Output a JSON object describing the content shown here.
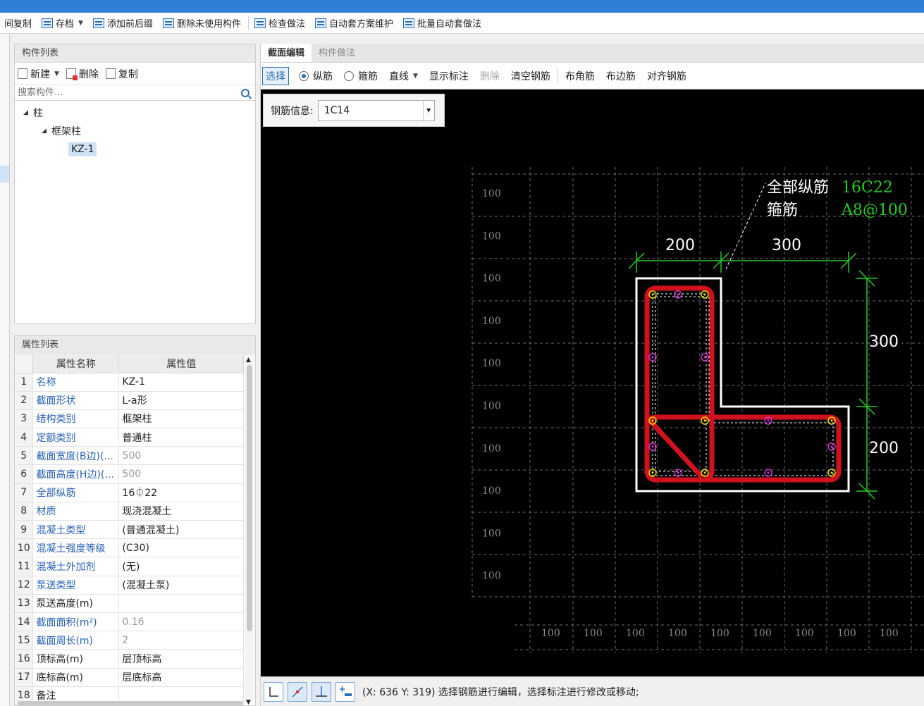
{
  "toolbar": {
    "items": [
      "间复制",
      "存档",
      "添加前后缀",
      "删除未使用构件",
      "检查做法",
      "自动套方案维护",
      "批量自动套做法"
    ]
  },
  "component_panel": {
    "title": "构件列表",
    "new_label": "新建",
    "delete_label": "删除",
    "copy_label": "复制",
    "search_placeholder": "搜索构件...",
    "tree": {
      "root": "柱",
      "child": "框架柱",
      "leaf": "KZ-1"
    }
  },
  "property_panel": {
    "title": "属性列表",
    "col_name": "属性名称",
    "col_value": "属性值",
    "rows": [
      {
        "n": "1",
        "name": "名称",
        "value": "KZ-1"
      },
      {
        "n": "2",
        "name": "截面形状",
        "value": "L-a形"
      },
      {
        "n": "3",
        "name": "结构类别",
        "value": "框架柱"
      },
      {
        "n": "4",
        "name": "定额类别",
        "value": "普通柱"
      },
      {
        "n": "5",
        "name": "截面宽度(B边)(...",
        "value": "500"
      },
      {
        "n": "6",
        "name": "截面高度(H边)(...",
        "value": "500"
      },
      {
        "n": "7",
        "name": "全部纵筋",
        "value": "16⏀22"
      },
      {
        "n": "8",
        "name": "材质",
        "value": "现浇混凝土"
      },
      {
        "n": "9",
        "name": "混凝土类型",
        "value": "(普通混凝土)"
      },
      {
        "n": "10",
        "name": "混凝土强度等级",
        "value": "(C30)"
      },
      {
        "n": "11",
        "name": "混凝土外加剂",
        "value": "(无)"
      },
      {
        "n": "12",
        "name": "泵送类型",
        "value": "(混凝土泵)"
      },
      {
        "n": "13",
        "name": "泵送高度(m)",
        "value": ""
      },
      {
        "n": "14",
        "name": "截面面积(m²)",
        "value": "0.16"
      },
      {
        "n": "15",
        "name": "截面周长(m)",
        "value": "2"
      },
      {
        "n": "16",
        "name": "顶标高(m)",
        "value": "层顶标高"
      },
      {
        "n": "17",
        "name": "底标高(m)",
        "value": "层底标高"
      },
      {
        "n": "18",
        "name": "备注",
        "value": ""
      }
    ]
  },
  "editor": {
    "tab_section": "截面编辑",
    "tab_method": "构件做法",
    "select_label": "选择",
    "longitudinal_label": "纵筋",
    "stirrup_label": "箍筋",
    "line_label": "直线",
    "show_dim_label": "显示标注",
    "delete_label": "删除",
    "clear_label": "清空钢筋",
    "corner_label": "布角筋",
    "edge_label": "布边筋",
    "align_label": "对齐钢筋",
    "rebar_info_label": "钢筋信息:",
    "rebar_info_value": "1C14"
  },
  "drawing": {
    "all_long_label": "全部纵筋",
    "all_long_value": "16C22",
    "stirrup_label": "箍筋",
    "stirrup_value": "A8@100",
    "dim_top_left": "200",
    "dim_top_right": "300",
    "dim_right_top": "300",
    "dim_right_bottom": "200",
    "grid_label": "100"
  },
  "status": {
    "text": "(X: 636 Y: 319) 选择钢筋进行编辑，选择标注进行修改或移动;"
  },
  "colors": {
    "accent": "#2d6db3",
    "rebar_red": "#d0121e",
    "dim_green": "#22cc22",
    "rebar_point_yellow": "#e8d800",
    "rebar_point_magenta": "#cc33cc"
  }
}
